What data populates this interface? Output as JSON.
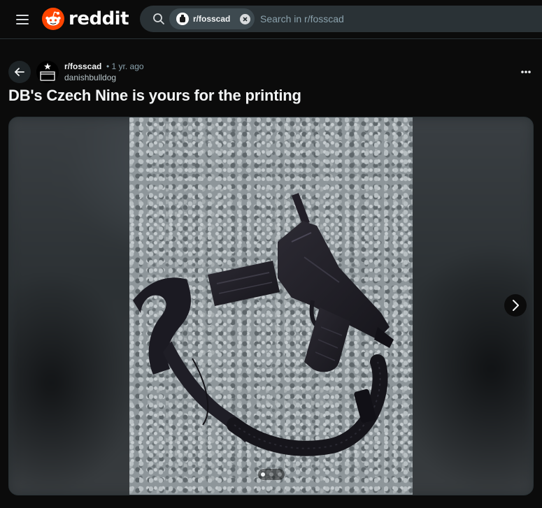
{
  "header": {
    "logo_text": "reddit",
    "search": {
      "chip_label": "r/fosscad",
      "placeholder": "Search in r/fosscad"
    }
  },
  "post": {
    "subreddit": "r/fosscad",
    "time": "• 1 yr. ago",
    "author": "danishbulldog",
    "title": "DB's Czech Nine is yours for the printing",
    "gallery": {
      "image_count": 3,
      "current_index": 1
    }
  },
  "icons": {
    "menu": "hamburger-icon",
    "logo": "reddit-snoo-icon",
    "search": "search-icon",
    "close": "close-icon",
    "back": "arrow-left-icon",
    "more": "ellipsis-icon",
    "next": "chevron-right-icon"
  },
  "colors": {
    "brand": "#ff4500",
    "background": "#0b0b0b",
    "search_bg": "#2a3236",
    "text_secondary": "#8ba2ad"
  }
}
